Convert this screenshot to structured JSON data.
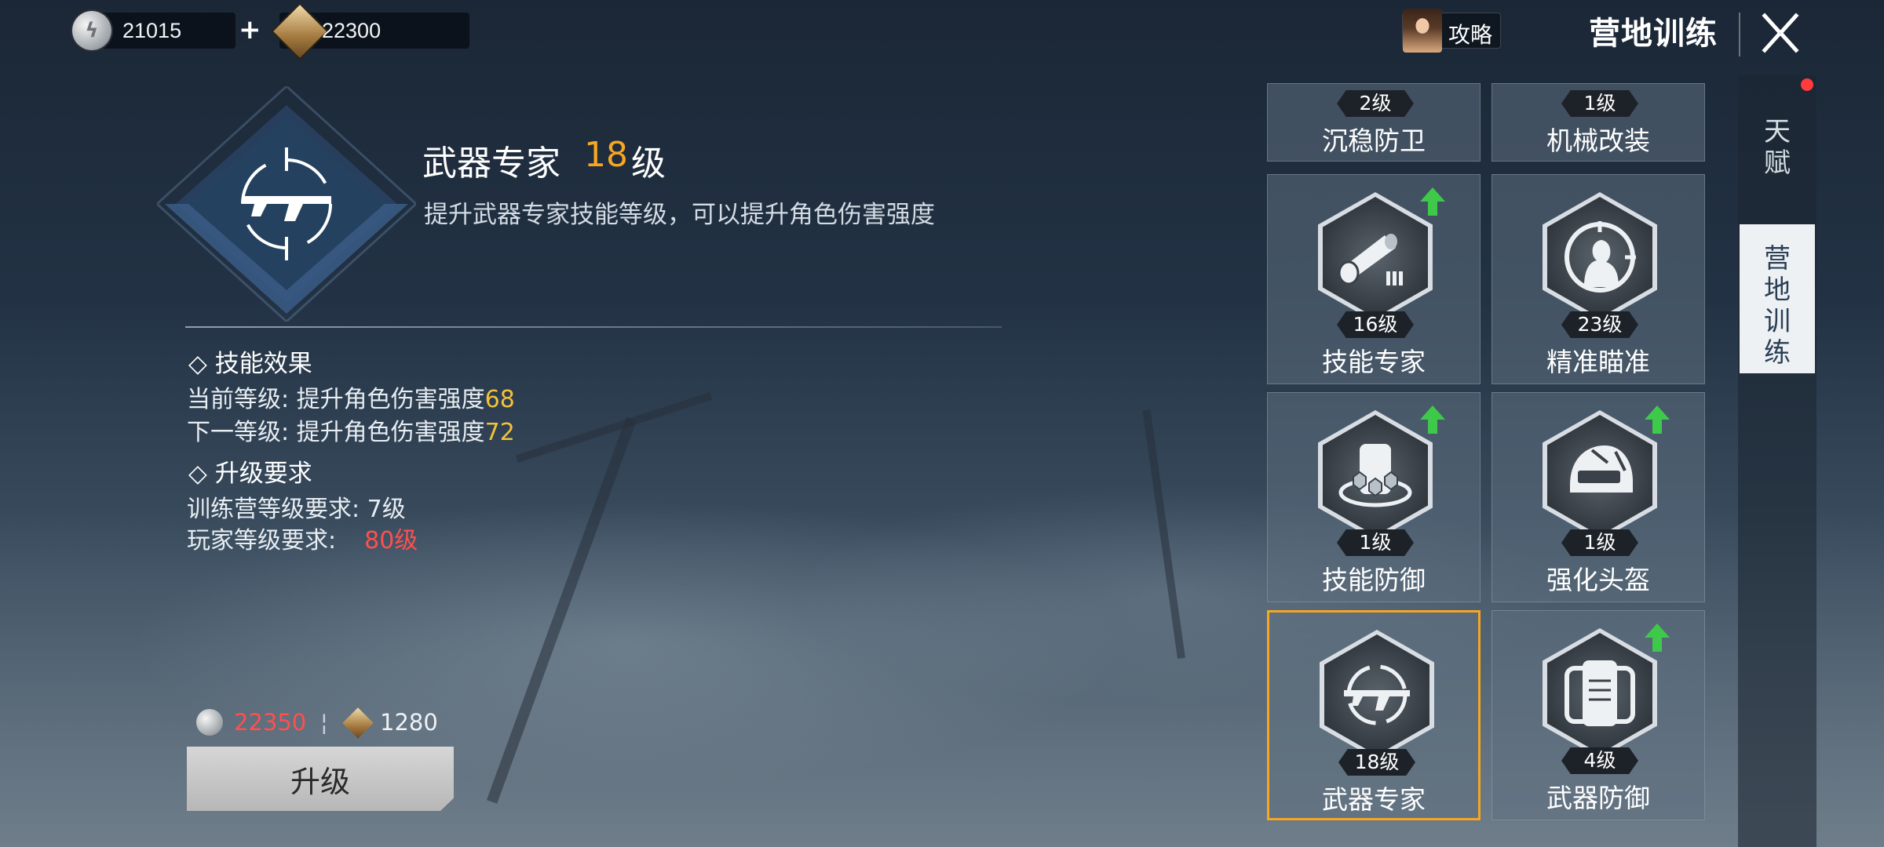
{
  "currency": {
    "silver": "21015",
    "plus_label": "+",
    "token": "22300"
  },
  "header": {
    "guide_label": "攻略",
    "title": "营地训练"
  },
  "detail": {
    "skill_name": "武器专家",
    "skill_level": "18",
    "skill_level_unit": "级",
    "description": "提升武器专家技能等级，可以提升角色伤害强度",
    "effect_heading": "◇ 技能效果",
    "current_label": "当前等级: 提升角色伤害强度",
    "current_value": "68",
    "next_label": "下一等级: 提升角色伤害强度",
    "next_value": "72",
    "req_heading": "◇ 升级要求",
    "camp_req_label": "训练营等级要求: 7级",
    "player_req_label": "玩家等级要求:",
    "player_req_value": "80级"
  },
  "cost": {
    "silver": "22350",
    "separator": "¦",
    "token": "1280",
    "upgrade_label": "升级"
  },
  "skills": [
    {
      "name": "沉稳防卫",
      "level": "2级",
      "icon": "shield-icon"
    },
    {
      "name": "机械改装",
      "level": "1级",
      "icon": "wrench-icon"
    },
    {
      "name": "技能专家",
      "level": "16级",
      "icon": "scope-icon",
      "upgradable": true
    },
    {
      "name": "精准瞄准",
      "level": "23级",
      "icon": "crosshair-head-icon",
      "upgradable": false
    },
    {
      "name": "技能防御",
      "level": "1级",
      "icon": "hex-shield-icon",
      "upgradable": true
    },
    {
      "name": "强化头盔",
      "level": "1级",
      "icon": "helmet-icon",
      "upgradable": true
    },
    {
      "name": "武器专家",
      "level": "18级",
      "icon": "rifle-crosshair-icon",
      "upgradable": false,
      "selected": true
    },
    {
      "name": "武器防御",
      "level": "4级",
      "icon": "armor-vest-icon",
      "upgradable": true
    }
  ],
  "tabs": [
    {
      "label_1": "天",
      "label_2": "赋"
    },
    {
      "label_1": "营",
      "label_2": "地",
      "label_3": "训",
      "label_4": "练"
    }
  ],
  "colors": {
    "accent_orange": "#f6a623",
    "value_yellow": "#f2c23a",
    "warning_red": "#ff4f4f",
    "upgrade_green": "#3ec94a"
  }
}
